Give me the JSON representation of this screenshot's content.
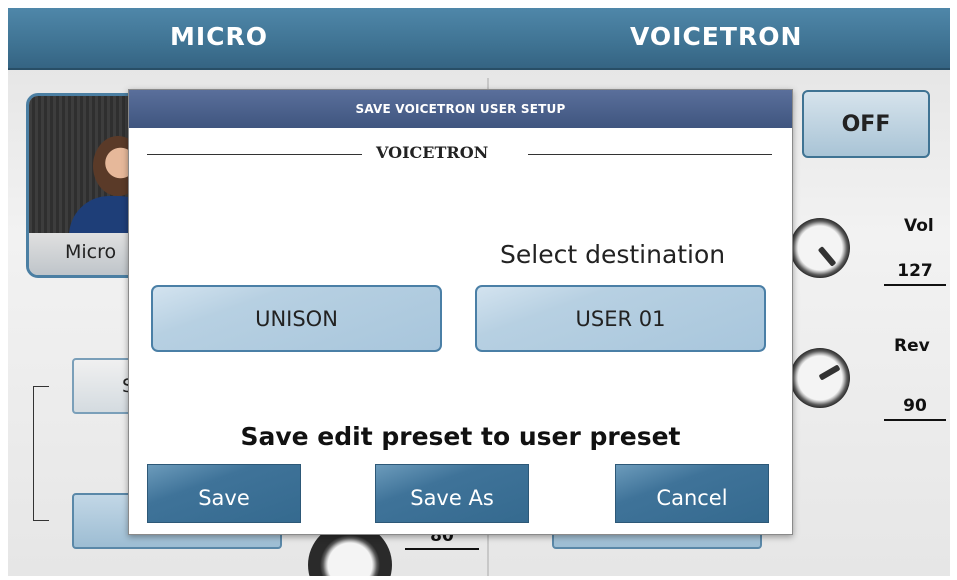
{
  "header": {
    "left_title": "MICRO",
    "right_title": "VOICETRON"
  },
  "background": {
    "micro_card_label": "Micro",
    "off_button": "OFF",
    "vol": {
      "label": "Vol",
      "value": "127"
    },
    "rev": {
      "label": "Rev",
      "value": "90"
    },
    "bottom_value": "80",
    "side_button_partial": "S"
  },
  "dialog": {
    "title": "SAVE VOICETRON USER SETUP",
    "section_label": "VOICETRON",
    "destination_label": "Select destination",
    "source_value": "UNISON",
    "destination_value": "USER 01",
    "message": "Save edit preset to user preset",
    "buttons": {
      "save": "Save",
      "save_as": "Save As",
      "cancel": "Cancel"
    }
  },
  "colors": {
    "header": "#3f7393",
    "dialog_title": "#4a5f8d",
    "button": "#3f7399"
  }
}
